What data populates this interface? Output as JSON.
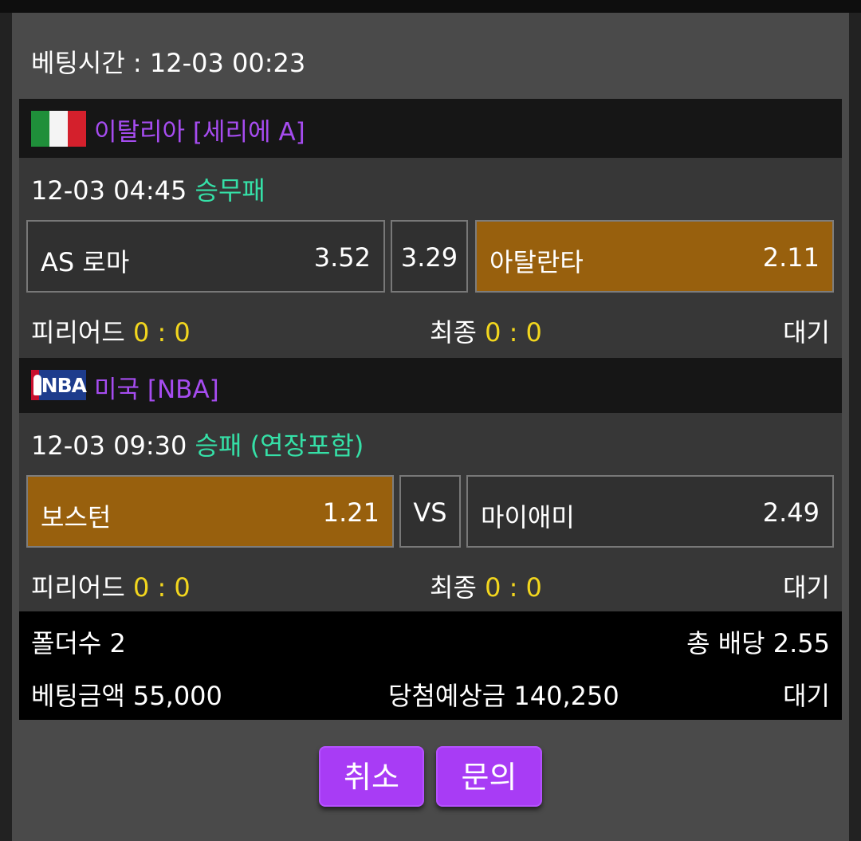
{
  "bet_time": "베팅시간 : 12-03 00:23",
  "games": [
    {
      "league": "이탈리아 [세리에 A]",
      "flag_icon": "italy-flag-icon",
      "time": "12-03 04:45",
      "bet_type": "승무패",
      "home": {
        "name": "AS 로마",
        "odds": "3.52",
        "selected": false
      },
      "middle": {
        "label": "3.29",
        "selected": false
      },
      "away": {
        "name": "아탈란타",
        "odds": "2.11",
        "selected": true
      },
      "period_label": "피리어드",
      "period_score": "0 : 0",
      "final_label": "최종",
      "final_score": "0 : 0",
      "status": "대기"
    },
    {
      "league": "미국 [NBA]",
      "flag_icon": "nba-logo-icon",
      "time": "12-03 09:30",
      "bet_type": "승패 (연장포함)",
      "home": {
        "name": "보스턴",
        "odds": "1.21",
        "selected": true
      },
      "middle": {
        "label": "VS",
        "selected": false
      },
      "away": {
        "name": "마이애미",
        "odds": "2.49",
        "selected": false
      },
      "period_label": "피리어드",
      "period_score": "0 : 0",
      "final_label": "최종",
      "final_score": "0 : 0",
      "status": "대기"
    }
  ],
  "summary": {
    "folders": "폴더수 2",
    "total_odds": "총 배당 2.55",
    "bet_amount": "베팅금액 55,000",
    "expected_win": "당첨예상금 140,250",
    "status": "대기"
  },
  "buttons": {
    "cancel": "취소",
    "inquiry": "문의"
  },
  "colors": {
    "league_name": "#a64cf0",
    "bet_type": "#35e0a7",
    "score": "#f2d61e",
    "selected_odds": "#98600d",
    "button": "#a83cf5"
  }
}
